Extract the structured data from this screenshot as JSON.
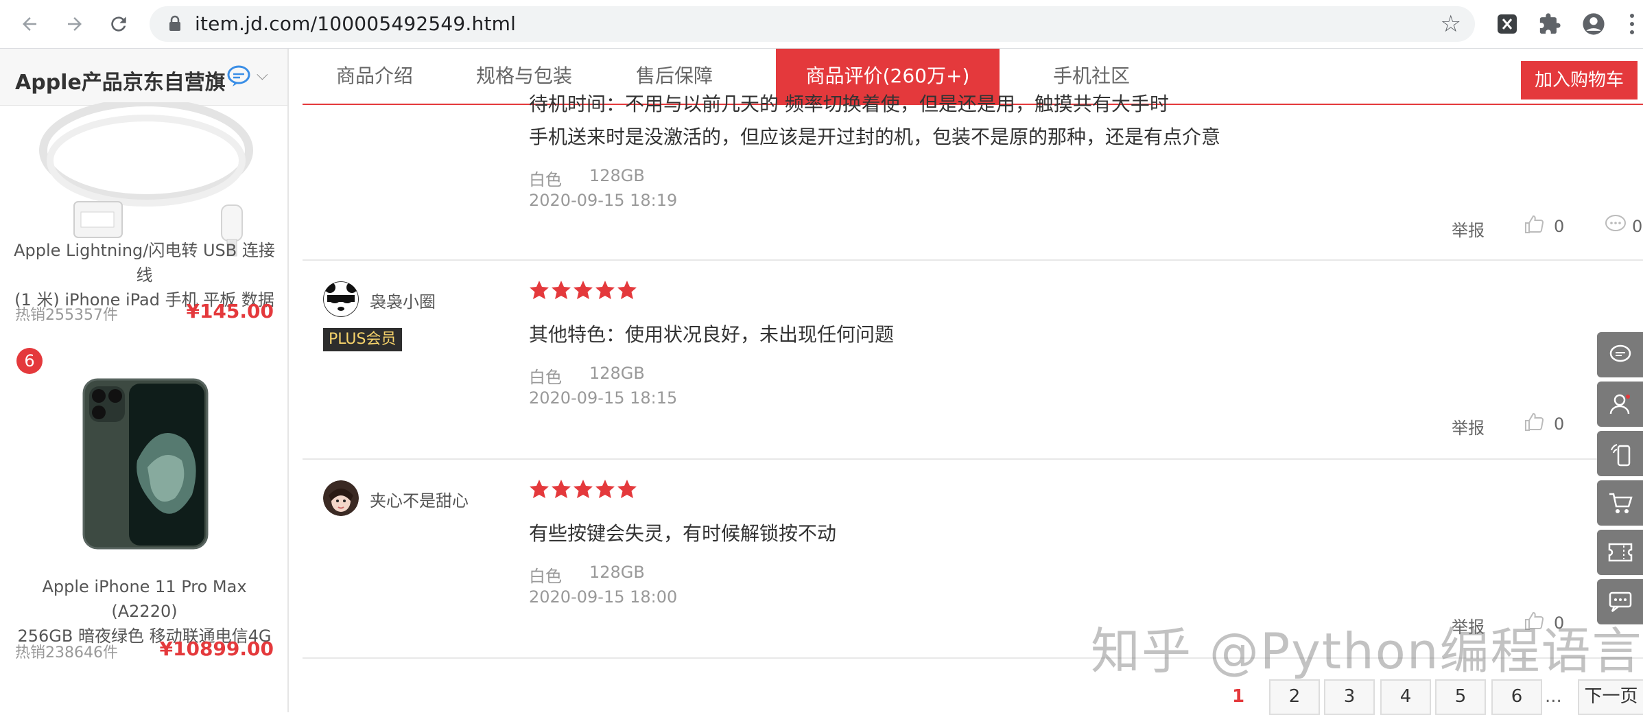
{
  "browser": {
    "url": "item.jd.com/100005492549.html"
  },
  "sidebar": {
    "shop_name": "Apple产品京东自营旗",
    "products": [
      {
        "title_line1": "Apple Lightning/闪电转 USB 连接线",
        "title_line2": "(1 米) iPhone iPad 手机 平板 数据",
        "hot": "热销255357件",
        "price": "¥145.00"
      },
      {
        "rank": "6",
        "title_line1": "Apple iPhone 11 Pro Max (A2220)",
        "title_line2": "256GB 暗夜绿色 移动联通电信4G",
        "hot": "热销238646件",
        "price": "¥10899.00"
      }
    ]
  },
  "tabs": {
    "items": [
      "商品介绍",
      "规格与包装",
      "售后保障",
      "商品评价(260万+)",
      "手机社区"
    ],
    "active_index": 3,
    "add_cart": "加入购物车"
  },
  "reviews": [
    {
      "cut_line": "待机时间：不用与以前几天的 频率切换着使，但是还是用，触摸共有大手时",
      "content": "手机送来时是没激活的，但应该是开过封的机，包装不是原的那种，还是有点介意",
      "color": "白色",
      "storage": "128GB",
      "time": "2020-09-15 18:19",
      "report": "举报",
      "likes": "0",
      "comments": "0"
    },
    {
      "user": "袅袅小圈",
      "badge": "PLUS会员",
      "stars": 5,
      "content": "其他特色：使用状况良好，未出现任何问题",
      "color": "白色",
      "storage": "128GB",
      "time": "2020-09-15 18:15",
      "report": "举报",
      "likes": "0"
    },
    {
      "user": "夹心不是甜心",
      "stars": 5,
      "content": "有些按键会失灵，有时候解锁按不动",
      "color": "白色",
      "storage": "128GB",
      "time": "2020-09-15 18:00",
      "report": "举报",
      "likes": "0"
    }
  ],
  "pagination": {
    "current": "1",
    "pages": [
      "2",
      "3",
      "4",
      "5",
      "6"
    ],
    "ellipsis": "...",
    "next": "下一页"
  },
  "watermark": "知乎 @Python编程语言",
  "colors": {
    "accent": "#e4393c",
    "toolbar": "#7a7a7a"
  }
}
